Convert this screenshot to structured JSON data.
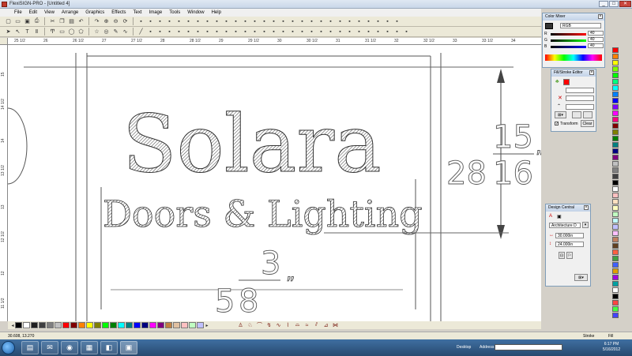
{
  "window": {
    "title": "FlexiSIGN-PRO - [Untitled 4]"
  },
  "menu": [
    "File",
    "Edit",
    "View",
    "Arrange",
    "Graphics",
    "Effects",
    "Text",
    "Image",
    "Tools",
    "Window",
    "Help"
  ],
  "toolbar1_icons": [
    "new-icon",
    "open-icon",
    "save-icon",
    "print-icon",
    "cut-icon",
    "copy-icon",
    "paste-icon",
    "undo-icon",
    "redo-icon",
    "zoom-in-icon",
    "zoom-out-icon",
    "refresh-icon"
  ],
  "toolbar2_icons": [
    "select-icon",
    "node-icon",
    "text-icon",
    "vertical-text-icon",
    "path-text-icon",
    "rect-icon",
    "ellipse-icon",
    "polygon-icon",
    "star-icon",
    "spiral-icon",
    "pen-icon",
    "bezier-icon",
    "line-icon"
  ],
  "ruler": {
    "h_ticks": [
      "25 1/2",
      "26",
      "26 1/2",
      "27",
      "27 1/2",
      "28",
      "28 1/2",
      "29",
      "29 1/2",
      "30",
      "30 1/2",
      "31",
      "31 1/2",
      "32",
      "32 1/2",
      "33",
      "33 1/2",
      "34"
    ],
    "v_ticks": [
      "15",
      "14 1/2",
      "14",
      "13 1/2",
      "13",
      "12 1/2",
      "12",
      "11 1/2"
    ]
  },
  "artwork": {
    "title_text": "Solara",
    "subtitle_text": "Doors & Lighting",
    "height_dim": {
      "whole": "28",
      "num": "15",
      "den": "16",
      "unit": "”"
    },
    "width_dim": {
      "whole": "5",
      "num": "3",
      "den": "8",
      "unit": "”"
    }
  },
  "status": {
    "coords": "30.608,    13.270",
    "stroke": "Stroke",
    "fill": "Fill"
  },
  "color_mixer": {
    "title": "Color Mixer",
    "mode": "RGB",
    "r_label": "R",
    "g_label": "G",
    "b_label": "B",
    "r": "40",
    "g": "40",
    "b": "40"
  },
  "fill_stroke": {
    "title": "Fill/Stroke Editor",
    "transform_label": "Transform",
    "clear_label": "Clear"
  },
  "design_central": {
    "title": "Design Central",
    "font": "Architecture D",
    "width_value": "30.000in",
    "height_value": "24.000in"
  },
  "taskbar": {
    "desktop_label": "Desktop",
    "address_label": "Address",
    "time": "6:17 PM",
    "date": "5/16/2012"
  },
  "colors": {
    "palette": [
      "#000000",
      "#ffffff",
      "#202020",
      "#404040",
      "#808080",
      "#c0c0c0",
      "#ff0000",
      "#800000",
      "#ff8000",
      "#ffff00",
      "#808000",
      "#00ff00",
      "#008000",
      "#00ffff",
      "#008080",
      "#0000ff",
      "#000080",
      "#ff00ff",
      "#800080",
      "#c08040",
      "#e0c0a0",
      "#ffc0c0",
      "#c0ffc0",
      "#c0c0ff"
    ],
    "right_column": [
      "#ff0000",
      "#ff8000",
      "#ffff00",
      "#80ff00",
      "#00ff00",
      "#00ff80",
      "#00ffff",
      "#0080ff",
      "#0000ff",
      "#8000ff",
      "#ff00ff",
      "#ff0080",
      "#800000",
      "#808000",
      "#008000",
      "#008080",
      "#000080",
      "#800080",
      "#c0c0c0",
      "#808080",
      "#404040",
      "#000000",
      "#ffffff",
      "#ffc0c0",
      "#ffe0c0",
      "#ffffc0",
      "#c0ffc0",
      "#c0ffff",
      "#c0c0ff",
      "#ffc0ff",
      "#c08060",
      "#604020",
      "#ff6040",
      "#40a040",
      "#4060ff",
      "#e0a000",
      "#a000e0",
      "#00a0a0",
      "#ffffff",
      "#000000",
      "#ff4444",
      "#44ff44",
      "#4444ff"
    ]
  }
}
